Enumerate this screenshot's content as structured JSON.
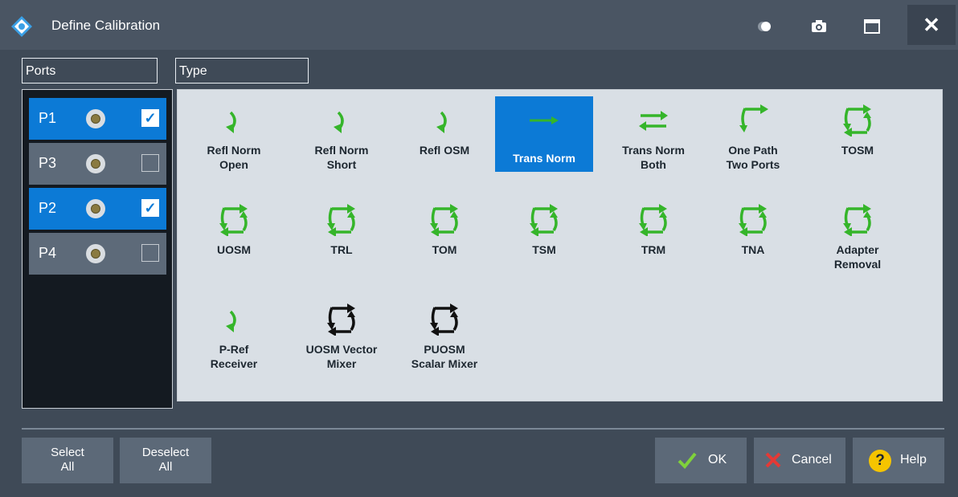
{
  "window": {
    "title": "Define Calibration",
    "close_glyph": "✕"
  },
  "headers": {
    "ports": "Ports",
    "type": "Type"
  },
  "ports": [
    {
      "label": "P1",
      "checked": true
    },
    {
      "label": "P3",
      "checked": false
    },
    {
      "label": "P2",
      "checked": true
    },
    {
      "label": "P4",
      "checked": false
    }
  ],
  "types": [
    {
      "label": "Refl Norm Open",
      "lines": [
        "Refl Norm",
        "Open"
      ],
      "icon": "refl-arrow-icon",
      "selected": false
    },
    {
      "label": "Refl Norm Short",
      "lines": [
        "Refl Norm",
        "Short"
      ],
      "icon": "refl-arrow-icon",
      "selected": false
    },
    {
      "label": "Refl OSM",
      "lines": [
        "Refl OSM"
      ],
      "icon": "refl-arrow-icon",
      "selected": false
    },
    {
      "label": "Trans Norm",
      "lines": [
        "Trans Norm"
      ],
      "icon": "trans-arrow-icon",
      "selected": true
    },
    {
      "label": "Trans Norm Both",
      "lines": [
        "Trans Norm",
        "Both"
      ],
      "icon": "bidirectional-arrows-icon",
      "selected": false
    },
    {
      "label": "One Path Two Ports",
      "lines": [
        "One Path",
        "Two Ports"
      ],
      "icon": "one-path-icon",
      "selected": false
    },
    {
      "label": "TOSM",
      "lines": [
        "TOSM"
      ],
      "icon": "two-port-cal-icon",
      "selected": false
    },
    {
      "label": "UOSM",
      "lines": [
        "UOSM"
      ],
      "icon": "two-port-cal-icon",
      "selected": false
    },
    {
      "label": "TRL",
      "lines": [
        "TRL"
      ],
      "icon": "two-port-cal-icon",
      "selected": false
    },
    {
      "label": "TOM",
      "lines": [
        "TOM"
      ],
      "icon": "two-port-cal-icon",
      "selected": false
    },
    {
      "label": "TSM",
      "lines": [
        "TSM"
      ],
      "icon": "two-port-cal-icon",
      "selected": false
    },
    {
      "label": "TRM",
      "lines": [
        "TRM"
      ],
      "icon": "two-port-cal-icon",
      "selected": false
    },
    {
      "label": "TNA",
      "lines": [
        "TNA"
      ],
      "icon": "two-port-cal-icon",
      "selected": false
    },
    {
      "label": "Adapter Removal",
      "lines": [
        "Adapter",
        "Removal"
      ],
      "icon": "two-port-cal-icon",
      "selected": false
    },
    {
      "label": "P-Ref Receiver",
      "lines": [
        "P-Ref",
        "Receiver"
      ],
      "icon": "refl-arrow-icon",
      "selected": false
    },
    {
      "label": "UOSM Vector Mixer",
      "lines": [
        "UOSM Vector",
        "Mixer"
      ],
      "icon": "mixer-cal-icon",
      "selected": false
    },
    {
      "label": "PUOSM Scalar Mixer",
      "lines": [
        "PUOSM",
        "Scalar Mixer"
      ],
      "icon": "mixer-cal-icon",
      "selected": false
    }
  ],
  "buttons": {
    "select_all": [
      "Select",
      "All"
    ],
    "deselect_all": [
      "Deselect",
      "All"
    ],
    "ok": "OK",
    "cancel": "Cancel",
    "help": "Help",
    "help_glyph": "?"
  },
  "colors": {
    "accent": "#0c7ad6",
    "icon_green": "#35b52a",
    "background": "#3f4a57"
  }
}
